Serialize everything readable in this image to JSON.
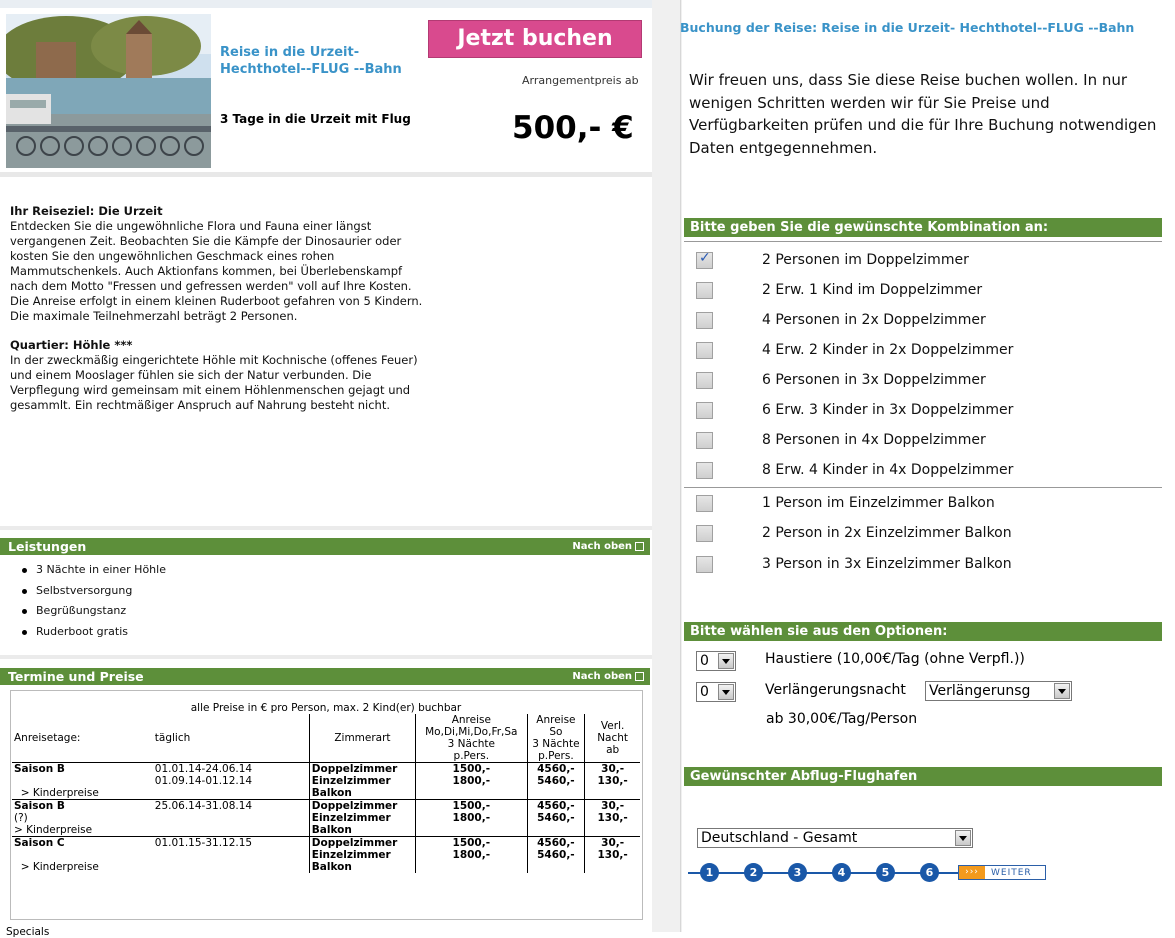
{
  "hero": {
    "title": "Reise in die Urzeit-Hechthotel--FLUG --Bahn",
    "subtitle": "3 Tage in die Urzeit mit Flug",
    "book_button": "Jetzt buchen",
    "price_label": "Arrangementpreis ab",
    "price": "500,- €"
  },
  "description": {
    "heading1": "Ihr Reiseziel: Die Urzeit",
    "text1": "Entdecken Sie die ungewöhnliche Flora und Fauna einer längst vergangenen Zeit. Beobachten Sie die Kämpfe der Dinosaurier oder kosten Sie den ungewöhnlichen Geschmack eines rohen Mammutschenkels. Auch Aktionfans kommen, bei Überlebenskampf nach dem Motto \"Fressen und gefressen werden\"  voll auf Ihre Kosten. Die Anreise erfolgt in einem kleinen Ruderboot gefahren von 5 Kindern. Die maximale Teilnehmerzahl beträgt 2 Personen.",
    "heading2": "Quartier: Höhle ***",
    "text2": "In der zweckmäßig eingerichtete Höhle mit Kochnische (offenes Feuer) und einem Mooslager fühlen sie sich der Natur verbunden. Die Verpflegung wird gemeinsam mit einem Höhlenmenschen gejagt und gesammlt. Ein rechtmäßiger Anspruch auf Nahrung besteht nicht."
  },
  "leistungen": {
    "title": "Leistungen",
    "nach_oben": "Nach oben",
    "items": [
      "3 Nächte in einer Höhle",
      "Selbstversorgung",
      "Begrüßungstanz",
      "Ruderboot gratis"
    ]
  },
  "termine": {
    "title": "Termine und Preise",
    "nach_oben": "Nach oben",
    "caption": "alle Preise in € pro Person, max. 2 Kind(er) buchbar",
    "col_anreisetage": "Anreisetage:",
    "col_taeglich": "täglich",
    "col_zimmerart": "Zimmerart",
    "col_a1": "Anreise",
    "col_a2": "Mo,Di,Mi,Do,Fr,Sa",
    "col_a3": "3 Nächte",
    "col_a4": "p.Pers.",
    "col_b1": "Anreise",
    "col_b2": "So",
    "col_b3": "3 Nächte",
    "col_b4": "p.Pers.",
    "col_c1": "Verl.",
    "col_c2": "Nacht",
    "col_c3": "ab",
    "kinderpreise": "> Kinderpreise",
    "q": "(?)",
    "s1_name": "Saison B",
    "s1_d1": "01.01.14-24.06.14",
    "s1_d2": "01.09.14-01.12.14",
    "s2_name": "Saison B",
    "s2_d1": "25.06.14-31.08.14",
    "s3_name": "Saison C",
    "s3_d1": "01.01.15-31.12.15",
    "dz": "Doppelzimmer",
    "ez1": "Einzelzimmer",
    "ez2": "Balkon",
    "p_dz_a": "1500,-",
    "p_dz_b": "4560,-",
    "p_dz_c": "30,-",
    "p_ez_a": "1800,-",
    "p_ez_b": "5460,-",
    "p_ez_c": "130,-"
  },
  "specials": "Specials",
  "booking": {
    "title": "Buchung der Reise: Reise in die Urzeit- Hechthotel--FLUG --Bahn",
    "intro": "Wir freuen uns, dass Sie diese Reise buchen wollen. In nur wenigen Schritten werden wir für Sie Preise und Verfügbarkeiten prüfen und die für Ihre Buchung notwendigen Daten entgegennehmen.",
    "combo_title": "Bitte geben Sie die gewünschte Kombination an:",
    "combos": [
      {
        "label": "2 Personen im Doppelzimmer",
        "checked": true
      },
      {
        "label": "2 Erw. 1 Kind im Doppelzimmer",
        "checked": false
      },
      {
        "label": "4 Personen in 2x Doppelzimmer",
        "checked": false
      },
      {
        "label": "4 Erw. 2 Kinder in 2x Doppelzimmer",
        "checked": false
      },
      {
        "label": "6 Personen in 3x Doppelzimmer",
        "checked": false
      },
      {
        "label": "6 Erw. 3 Kinder in 3x Doppelzimmer",
        "checked": false
      },
      {
        "label": "8 Personen in 4x Doppelzimmer",
        "checked": false
      },
      {
        "label": "8 Erw. 4 Kinder in 4x Doppelzimmer",
        "checked": false
      },
      {
        "label": "1 Person im Einzelzimmer Balkon",
        "checked": false
      },
      {
        "label": "2 Person in 2x Einzelzimmer Balkon",
        "checked": false
      },
      {
        "label": "3 Person in 3x Einzelzimmer Balkon",
        "checked": false
      }
    ],
    "options_title": "Bitte wählen sie aus den Optionen:",
    "pet_qty": "0",
    "pet_label": "Haustiere (10,00€/Tag (ohne Verpfl.))",
    "ext_qty": "0",
    "ext_label": "Verlängerungsnacht",
    "ext_select": "Verlängerunsg",
    "ext_price": "ab 30,00€/Tag/Person",
    "airport_title": "Gewünschter Abflug-Flughafen",
    "airport_select": "Deutschland - Gesamt",
    "steps": [
      "1",
      "2",
      "3",
      "4",
      "5",
      "6"
    ],
    "next": "WEITER"
  },
  "colors": {
    "green_bar": "#5d8f3a",
    "link_blue": "#3a93c8",
    "book_pink": "#d94a8e",
    "step_blue": "#1a58a8"
  }
}
